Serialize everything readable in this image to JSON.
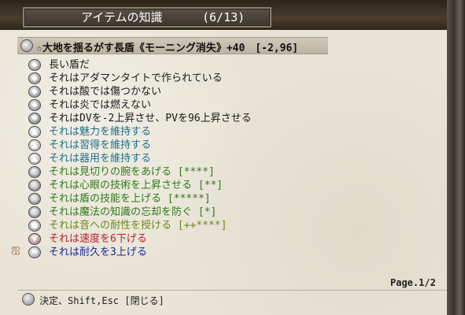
{
  "window": {
    "title": "アイテムの知識",
    "count": "(6/13)"
  },
  "item": {
    "name": "☆大地を揺るがす長盾《モーニング消失》+40　[-2,96]"
  },
  "properties": [
    {
      "text": "長い盾だ",
      "color": "#1a1a1a",
      "icon": "diamond-icon"
    },
    {
      "text": "それはアダマンタイトで作られている",
      "color": "#1a1a1a",
      "icon": "diamond-icon"
    },
    {
      "text": "それは酸では傷つかない",
      "color": "#1a1a1a",
      "icon": "diamond-icon"
    },
    {
      "text": "それは炎では燃えない",
      "color": "#1a1a1a",
      "icon": "diamond-icon"
    },
    {
      "text": "それはDVを-2上昇させ、PVを96上昇させる",
      "color": "#1a1a1a",
      "icon": "gear-icon"
    },
    {
      "text": "それは魅力を維持する",
      "color": "#1f6f8a",
      "icon": "shirt-icon"
    },
    {
      "text": "それは習得を維持する",
      "color": "#1f6f8a",
      "icon": "shirt-icon"
    },
    {
      "text": "それは器用を維持する",
      "color": "#1f6f8a",
      "icon": "shirt-icon"
    },
    {
      "text": "それは見切りの腕をあげる [****]",
      "color": "#2f7a1a",
      "icon": "spiral-icon"
    },
    {
      "text": "それは心眼の技術を上昇させる [**]",
      "color": "#2f7a1a",
      "icon": "spiral-icon"
    },
    {
      "text": "それは盾の技能を上げる [*****]",
      "color": "#2f7a1a",
      "icon": "spiral-icon"
    },
    {
      "text": "それは魔法の知識の忘却を防ぐ [*]",
      "color": "#2f7a1a",
      "icon": "spiral-icon"
    },
    {
      "text": "それは音への耐性を授ける [++****]",
      "color": "#6a8a1a",
      "icon": "orb-icon"
    },
    {
      "text": "それは速度を6下げる",
      "color": "#b8222a",
      "icon": "down-arrow-icon"
    },
    {
      "text": "それは耐久を3上げる",
      "color": "#1a2a9a",
      "icon": "arrow-icon"
    }
  ],
  "pagination": {
    "label": "Page.1/2"
  },
  "footer": {
    "hint": "決定、Shift,Esc [閉じる]"
  },
  "glyphs": {
    "diamond": "◆",
    "gear": "✱",
    "shirt": "▲",
    "spiral": "◎",
    "orb": "●",
    "down": "▼",
    "arrow": "➜",
    "moth": "ஐ"
  }
}
